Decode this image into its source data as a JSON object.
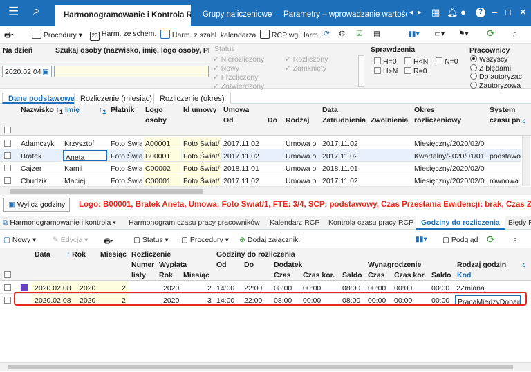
{
  "window": {
    "tabs": [
      {
        "label": "Harmonogramowanie i Kontrola RC"
      },
      {
        "label": "Grupy naliczeniowe"
      },
      {
        "label": "Parametry – wprowadzanie wartości"
      }
    ]
  },
  "toolbar": {
    "procedury": "Procedury",
    "harm_schem": "Harm. ze schem.",
    "harm_szabl": "Harm. z szabl. kalendarza",
    "rcp_harm": "RCP wg Harm."
  },
  "filter": {
    "na_dniu_label": "Na dzień",
    "date_value": "2020.02.04",
    "search_label": "Szukaj osoby (nazwisko, imię, logo osoby, PESEL)",
    "status_label": "Status",
    "status_items": [
      "Nierozliczony",
      "Nowy",
      "Przeliczony",
      "Zatwierdzony"
    ],
    "status_items2": [
      "Rozliczony",
      "Zamknięty"
    ],
    "sprawdzenia_label": "Sprawdzenia",
    "spr": [
      "H=0",
      "H<N",
      "N=0",
      "H>N",
      "R=0"
    ],
    "pracownicy_label": "Pracownicy",
    "pracownicy": [
      "Wszyscy",
      "Z błędami",
      "Do autoryzac",
      "Zautoryzowa"
    ]
  },
  "upper_tabs": [
    "Dane podstawowe",
    "Rozliczenie (miesiąc)",
    "Rozliczenie (okres)"
  ],
  "upper_grid": {
    "headers": {
      "nazwisko": "Nazwisko",
      "imie": "Imię",
      "platnik": "Płatnik",
      "logo": "Logo",
      "osoby": "osoby",
      "id_umowy": "Id umowy",
      "umowa": "Umowa",
      "od": "Od",
      "do": "Do",
      "rodzaj": "Rodzaj",
      "data": "Data",
      "zatrudnienia": "Zatrudnienia",
      "zwolnienia": "Zwolnienia",
      "okres": "Okres",
      "rozliczeniowy": "rozliczeniowy",
      "system": "System",
      "czasu_pracy": "czasu pra"
    },
    "sort_marks": [
      "1",
      "2"
    ],
    "rows": [
      {
        "nazwisko": "Adamczyk",
        "imie": "Krzysztof",
        "platnik": "Foto Świa",
        "logo": "A00001",
        "id": "Foto Świat/",
        "od": "2017.11.02",
        "rodzaj": "Umowa o",
        "zatr": "2017.11.02",
        "okres": "Miesięczny/2020/02/0",
        "system": ""
      },
      {
        "nazwisko": "Bratek",
        "imie": "Aneta",
        "platnik": "Foto Świa",
        "logo": "B00001",
        "id": "Foto Świat/",
        "od": "2017.11.02",
        "rodzaj": "Umowa o",
        "zatr": "2017.11.02",
        "okres": "Kwartalny/2020/01/01",
        "system": "podstawo"
      },
      {
        "nazwisko": "Cajzer",
        "imie": "Kamil",
        "platnik": "Foto Świa",
        "logo": "C00002",
        "id": "Foto Świat/",
        "od": "2018.11.01",
        "rodzaj": "Umowa o",
        "zatr": "2018.11.01",
        "okres": "Miesięczny/2020/02/0",
        "system": ""
      },
      {
        "nazwisko": "Chudzik",
        "imie": "Maciej",
        "platnik": "Foto Świa",
        "logo": "C00001",
        "id": "Foto Świat/",
        "od": "2017.11.02",
        "rodzaj": "Umowa o",
        "zatr": "2017.11.02",
        "okres": "Miesięczny/2020/02/0",
        "system": "równowa"
      }
    ]
  },
  "message": {
    "button": "Wylicz godziny",
    "text": "Logo: B00001, Bratek Aneta, Umowa: Foto Świat/1, FTE: 3/4, SCP: podstawowy, Czas Przesłania Ewidencji: brak, Czas Zar"
  },
  "lower_tabs": {
    "dropdown": "Harmonogramowanie i kontrola",
    "tabs": [
      "Harmonogram czasu pracy pracowników",
      "Kalendarz RCP",
      "Kontrola czasu pracy RCP",
      "Godziny do rozliczenia",
      "Błędy R"
    ]
  },
  "lower_toolbar": {
    "nowy": "Nowy",
    "edycja": "Edycja",
    "status": "Status",
    "procedury": "Procedury",
    "zalaczniki": "Dodaj załączniki",
    "podglad": "Podgląd"
  },
  "lower_grid": {
    "headers": {
      "data": "Data",
      "rok": "Rok",
      "miesiac": "Miesiąc",
      "rozliczenie": "Rozliczenie",
      "numer": "Numer",
      "listy": "listy",
      "wyplata": "Wypłata",
      "w_rok": "Rok",
      "w_mies": "Miesiąc",
      "godziny": "Godziny do rozliczenia",
      "od": "Od",
      "do": "Do",
      "dodatek": "Dodatek",
      "czas": "Czas",
      "czas_kor": "Czas kor.",
      "saldo": "Saldo",
      "wynagrodzenie": "Wynagrodzenie",
      "rodzaj": "Rodzaj godzin",
      "kod": "Kod"
    },
    "sort_mark": "1",
    "rows": [
      {
        "data": "2020.02.08",
        "rok": "2020",
        "mies": "2",
        "w_rok": "2020",
        "w_mies": "2",
        "od": "14:00",
        "do": "22:00",
        "d_czas": "08:00",
        "d_kor": "00:00",
        "d_saldo": "08:00",
        "w_czas": "00:00",
        "w_kor": "00:00",
        "w_saldo": "00:00",
        "kod": "2Zmiana"
      },
      {
        "data": "2020.02.08",
        "rok": "2020",
        "mies": "2",
        "w_rok": "2020",
        "w_mies": "3",
        "od": "14:00",
        "do": "22:00",
        "d_czas": "08:00",
        "d_kor": "00:00",
        "d_saldo": "08:00",
        "w_czas": "00:00",
        "w_kor": "00:00",
        "w_saldo": "00:00",
        "kod": "PracaMiedzyDobami"
      }
    ]
  },
  "colors": {
    "accent": "#1c6fb8",
    "highlight_red": "#e8281e",
    "marker_purple": "#6a3fc4"
  }
}
